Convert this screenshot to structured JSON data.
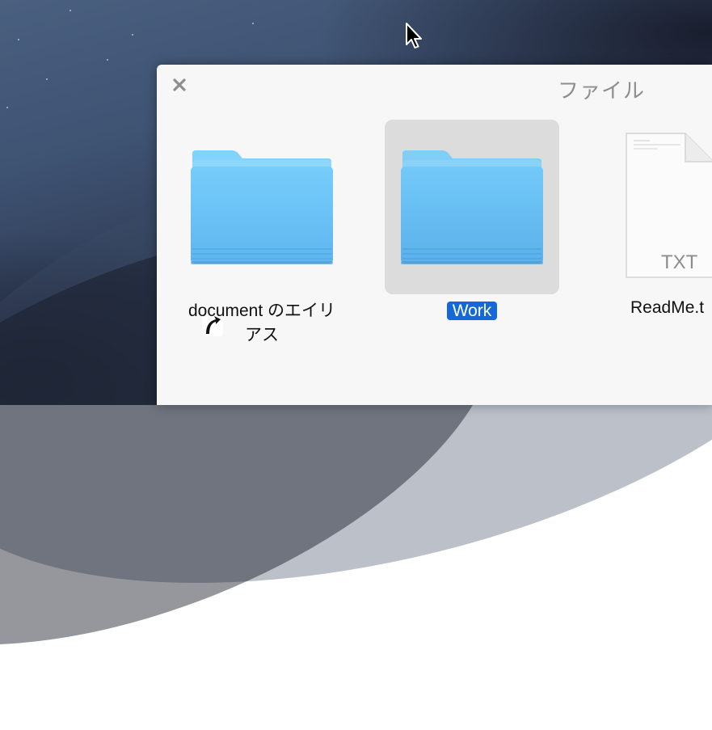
{
  "panel": {
    "title": "ファイル",
    "close_icon": "close-icon"
  },
  "items": [
    {
      "label_line1": "document のエイリ",
      "label_line2": "アス",
      "icon": "folder-alias-icon",
      "selected": false
    },
    {
      "label": "Work",
      "icon": "folder-icon",
      "selected": true
    },
    {
      "label": "ReadMe.t",
      "icon": "text-document-icon",
      "file_badge": "TXT",
      "selected": false
    }
  ],
  "colors": {
    "selection_accent": "#1469d6",
    "folder_blue": "#6ec4f6",
    "panel_background": "#f7f7f7"
  }
}
